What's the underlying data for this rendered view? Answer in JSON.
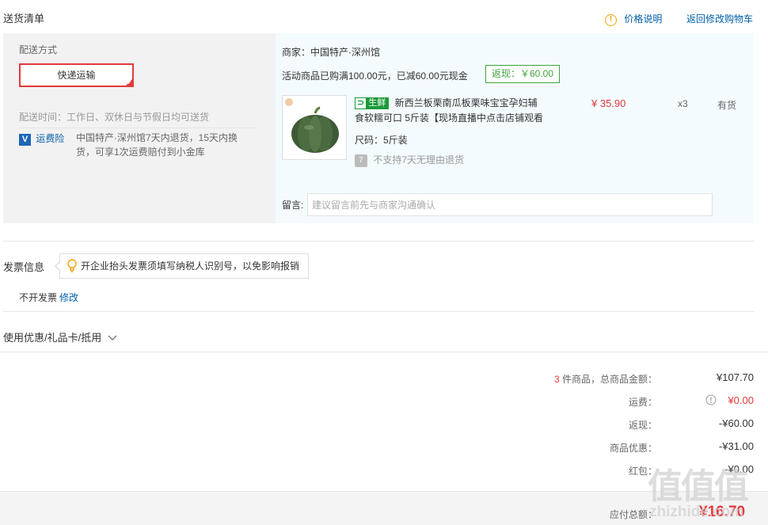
{
  "header": {
    "title": "送货清单",
    "price_help": "价格说明",
    "back_to_cart": "返回修改购物车"
  },
  "shipping": {
    "method_label": "配送方式",
    "method_selected": "快递运输",
    "time_text": "配送时间：工作日、双休日与节假日均可送货",
    "insurance_label": "运费险",
    "insurance_desc_line1": "中国特产·深州馆7天内退货，15天内换",
    "insurance_desc_line2": "货，可享1次运费赔付到小金库"
  },
  "order": {
    "merchant": "商家：中国特产·深州馆",
    "promo_text": "活动商品已购满100.00元，已减60.00元现金",
    "cashback_badge": "返现：￥60.00",
    "product": {
      "tag_left": "生",
      "tag_right": "生鲜",
      "name_line1": "新西兰板栗南瓜板栗味宝宝孕妇辅",
      "name_line2": "食软糯可口 5斤装【现场直播中点击店铺观看",
      "spec": "尺码：5斤装",
      "return_policy": "不支持7天无理由退货",
      "price": "¥ 35.90",
      "quantity": "x3",
      "stock": "有货"
    },
    "memo_label": "留言:",
    "memo_placeholder": "建议留言前先与商家沟通确认"
  },
  "invoice": {
    "title": "发票信息",
    "tip": "开企业抬头发票须填写纳税人识别号，以免影响报销",
    "status": "不开发票",
    "edit": "修改"
  },
  "coupons": {
    "title": "使用优惠/礼品卡/抵用"
  },
  "summary": {
    "count": "3",
    "count_suffix": "件商品，总商品金额：",
    "total": "¥107.70",
    "shipping_label": "运费：",
    "shipping_value": "¥0.00",
    "cashback_label": "返现：",
    "cashback_value": "-¥60.00",
    "discount_label": "商品优惠：",
    "discount_value": "-¥31.00",
    "redpacket_label": "红包：",
    "redpacket_value": "-¥0.00",
    "payable_label": "应付总额：",
    "payable_value": "¥16.70"
  },
  "watermark": {
    "logo": "值值值",
    "site": "zhizhide.com"
  },
  "colors": {
    "accent_red": "#e4393c",
    "link_blue": "#005ea7",
    "green": "#3fa33f",
    "orange": "#f0a30a"
  }
}
